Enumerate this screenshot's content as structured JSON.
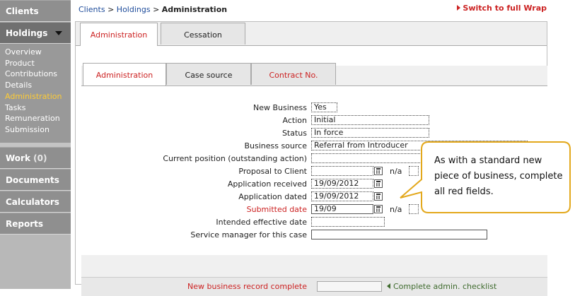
{
  "sidebar": {
    "clients": "Clients",
    "holdings": "Holdings",
    "holdings_items": [
      "Overview",
      "Product",
      "Contributions",
      "Details",
      "Administration",
      "Tasks",
      "Remuneration",
      "Submission"
    ],
    "work": "Work",
    "work_count": "(0)",
    "documents": "Documents",
    "calculators": "Calculators",
    "reports": "Reports"
  },
  "breadcrumb": {
    "clients": "Clients",
    "sep1": " > ",
    "holdings": "Holdings",
    "sep2": " > ",
    "current": "Administration"
  },
  "switch_link": "Switch to full Wrap",
  "outer_tabs": [
    "Administration",
    "Cessation"
  ],
  "inner_tabs": [
    "Administration",
    "Case source",
    "Contract No."
  ],
  "form": {
    "new_business": {
      "label": "New Business",
      "value": "Yes"
    },
    "action": {
      "label": "Action",
      "value": "Initial"
    },
    "status": {
      "label": "Status",
      "value": "In force"
    },
    "business_source": {
      "label": "Business source",
      "value": "Referral from Introducer"
    },
    "current_position": {
      "label": "Current position (outstanding action)",
      "value": ""
    },
    "proposal_to_client": {
      "label": "Proposal to Client",
      "value": "",
      "na": "n/a"
    },
    "application_received": {
      "label": "Application received",
      "value": "19/09/2012"
    },
    "application_dated": {
      "label": "Application dated",
      "value": "19/09/2012"
    },
    "submitted_date": {
      "label": "Submitted date",
      "value": "19/09",
      "na": "n/a"
    },
    "intended_effective_date": {
      "label": "Intended effective date",
      "value": ""
    },
    "service_manager": {
      "label": "Service manager for this case",
      "value": ""
    }
  },
  "footer": {
    "label": "New business record complete",
    "checklist": "Complete admin. checklist"
  },
  "callout": {
    "text": "As with a standard new piece of business, complete all red fields."
  },
  "colors": {
    "required": "#cc2222",
    "link": "#1d4b9a",
    "sidebar_current": "#ffcc33",
    "callout_border": "#e3a81c"
  }
}
